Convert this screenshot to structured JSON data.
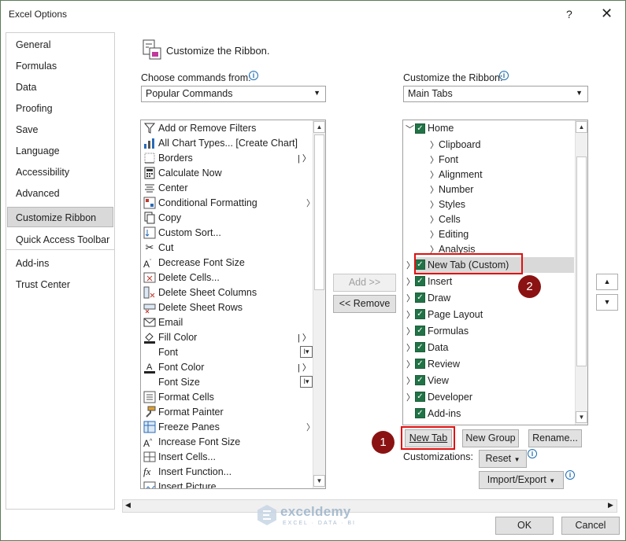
{
  "window": {
    "title": "Excel Options",
    "help": "?",
    "close": "✕"
  },
  "nav": {
    "items": [
      "General",
      "Formulas",
      "Data",
      "Proofing",
      "Save",
      "Language",
      "Accessibility",
      "Advanced",
      "Customize Ribbon",
      "Quick Access Toolbar",
      "Add-ins",
      "Trust Center"
    ],
    "selected": "Customize Ribbon"
  },
  "section": {
    "title": "Customize the Ribbon."
  },
  "left": {
    "label": "Choose commands from:",
    "combo_value": "Popular Commands",
    "commands": [
      "Add or Remove Filters",
      "All Chart Types... [Create Chart]",
      "Borders",
      "Calculate Now",
      "Center",
      "Conditional Formatting",
      "Copy",
      "Custom Sort...",
      "Cut",
      "Decrease Font Size",
      "Delete Cells...",
      "Delete Sheet Columns",
      "Delete Sheet Rows",
      "Email",
      "Fill Color",
      "Font",
      "Font Color",
      "Font Size",
      "Format Cells",
      "Format Painter",
      "Freeze Panes",
      "Increase Font Size",
      "Insert Cells...",
      "Insert Function...",
      "Insert Picture"
    ]
  },
  "middle": {
    "add": "Add >>",
    "remove": "<< Remove"
  },
  "right": {
    "label": "Customize the Ribbon:",
    "combo_value": "Main Tabs",
    "tree": [
      {
        "label": "Home",
        "level": 0,
        "expanded": true,
        "checked": true
      },
      {
        "label": "Clipboard",
        "level": 1
      },
      {
        "label": "Font",
        "level": 1
      },
      {
        "label": "Alignment",
        "level": 1
      },
      {
        "label": "Number",
        "level": 1
      },
      {
        "label": "Styles",
        "level": 1
      },
      {
        "label": "Cells",
        "level": 1
      },
      {
        "label": "Editing",
        "level": 1
      },
      {
        "label": "Analysis",
        "level": 1
      },
      {
        "label": "New Tab (Custom)",
        "level": 0,
        "checked": true,
        "selected": true
      },
      {
        "label": "Insert",
        "level": 0,
        "checked": true
      },
      {
        "label": "Draw",
        "level": 0,
        "checked": true
      },
      {
        "label": "Page Layout",
        "level": 0,
        "checked": true
      },
      {
        "label": "Formulas",
        "level": 0,
        "checked": true
      },
      {
        "label": "Data",
        "level": 0,
        "checked": true
      },
      {
        "label": "Review",
        "level": 0,
        "checked": true
      },
      {
        "label": "View",
        "level": 0,
        "checked": true
      },
      {
        "label": "Developer",
        "level": 0,
        "checked": true
      },
      {
        "label": "Add-ins",
        "level": 0,
        "checked": true
      }
    ],
    "new_tab": "New Tab",
    "new_group": "New Group",
    "rename": "Rename...",
    "customizations_label": "Customizations:",
    "reset": "Reset",
    "import_export": "Import/Export"
  },
  "callouts": {
    "one": "1",
    "two": "2"
  },
  "footer": {
    "ok": "OK",
    "cancel": "Cancel"
  },
  "watermark": {
    "name": "exceldemy",
    "tagline": "EXCEL · DATA · BI"
  }
}
